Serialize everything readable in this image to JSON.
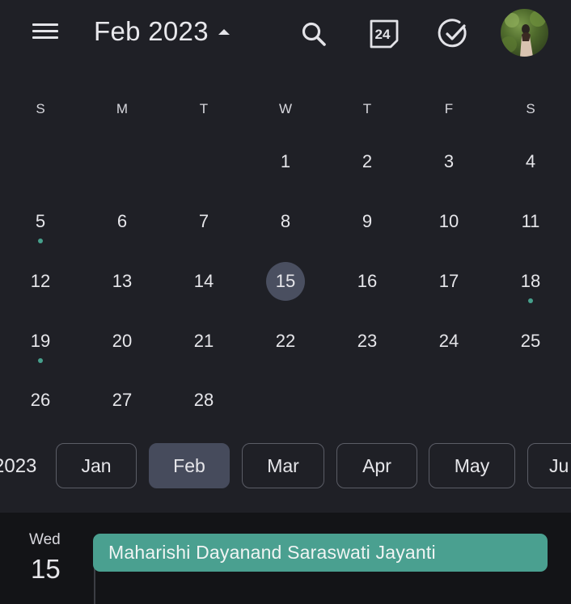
{
  "header": {
    "title": "Feb 2023",
    "today_icon_day": "24"
  },
  "weekdays": [
    "S",
    "M",
    "T",
    "W",
    "T",
    "F",
    "S"
  ],
  "calendar": {
    "selected_day": "15",
    "weeks": [
      [
        "",
        "",
        "",
        "1",
        "2",
        "3",
        "4"
      ],
      [
        "5",
        "6",
        "7",
        "8",
        "9",
        "10",
        "11"
      ],
      [
        "12",
        "13",
        "14",
        "15",
        "16",
        "17",
        "18"
      ],
      [
        "19",
        "20",
        "21",
        "22",
        "23",
        "24",
        "25"
      ],
      [
        "26",
        "27",
        "28",
        "",
        "",
        "",
        ""
      ]
    ],
    "event_dot_days": [
      "5",
      "18",
      "19"
    ],
    "event_dot_color": "#46a08c",
    "today_highlight_color": "#4a4f60"
  },
  "month_strip": {
    "year_label": "2023",
    "months": [
      "Jan",
      "Feb",
      "Mar",
      "Apr",
      "May",
      "Ju"
    ],
    "active": "Feb"
  },
  "agenda": {
    "day_of_week": "Wed",
    "day_number": "15",
    "event_title": "Maharishi Dayanand Saraswati Jayanti",
    "event_color": "#4aa090"
  },
  "colors": {
    "background": "#1f2026",
    "agenda_background": "#131417",
    "accent": "#46a08c"
  }
}
